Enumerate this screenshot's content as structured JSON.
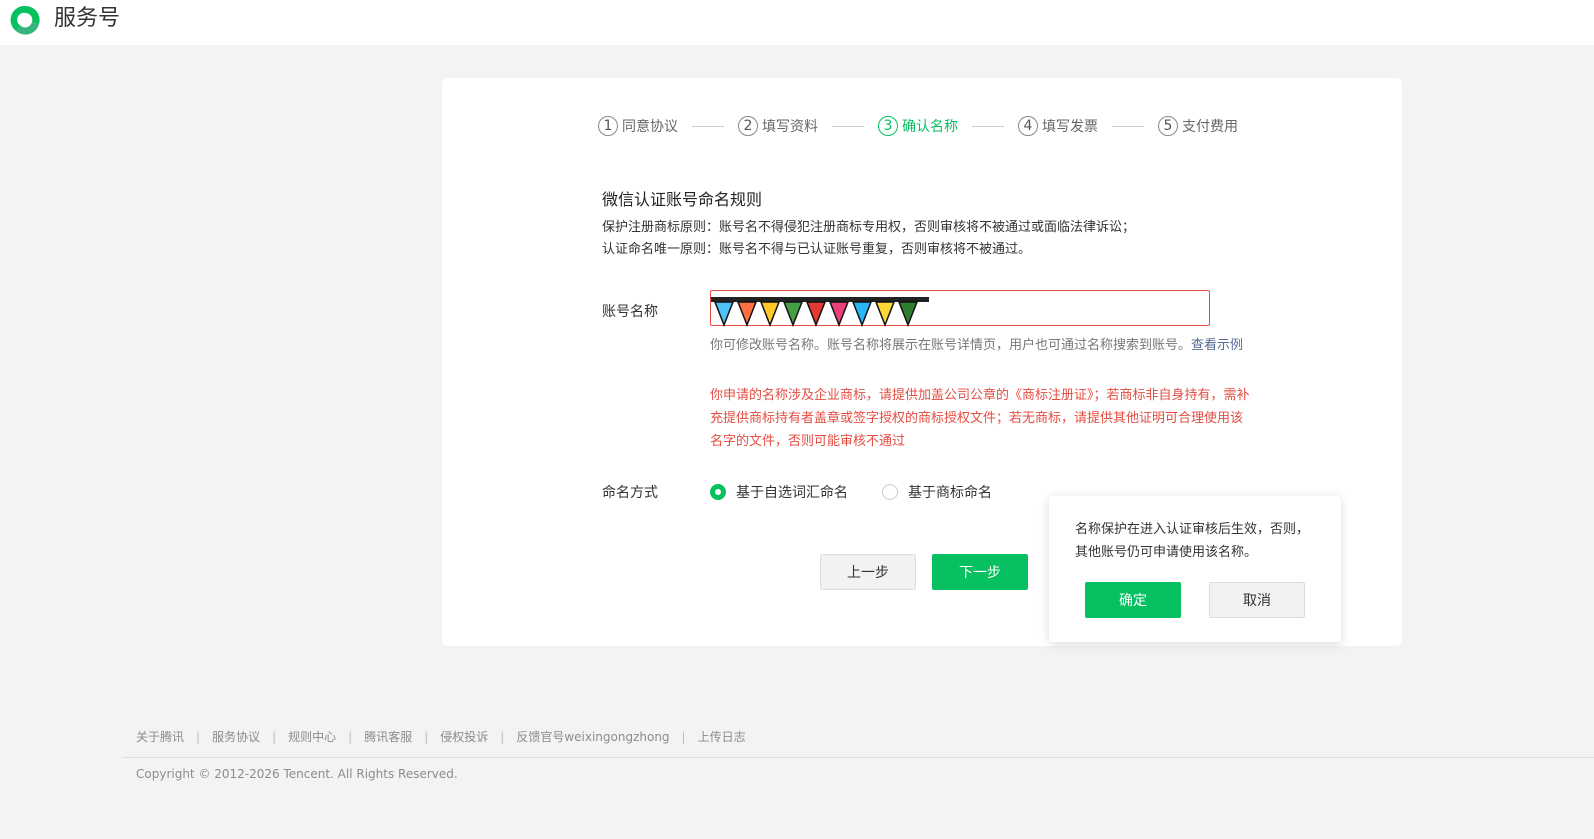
{
  "header": {
    "brand": "服务号",
    "accent_color": "#07c160"
  },
  "steps": [
    {
      "num": "1",
      "label": "同意协议"
    },
    {
      "num": "2",
      "label": "填写资料"
    },
    {
      "num": "3",
      "label": "确认名称"
    },
    {
      "num": "4",
      "label": "填写发票"
    },
    {
      "num": "5",
      "label": "支付费用"
    }
  ],
  "active_step": 3,
  "rules": {
    "title": "微信认证账号命名规则",
    "line1": "保护注册商标原则：账号名不得侵犯注册商标专用权，否则审核将不被通过或面临法律诉讼；",
    "line2": "认证命名唯一原则：账号名不得与已认证账号重复，否则审核将不被通过。"
  },
  "form": {
    "name_label": "账号名称",
    "name_value_icon": "flag-bunting-icon",
    "hint_text": "你可修改账号名称。账号名称将展示在账号详情页，用户也可通过名称搜索到账号。",
    "hint_link": "查看示例",
    "warning": "你申请的名称涉及企业商标，请提供加盖公司公章的《商标注册证》；若商标非自身持有，需补充提供商标持有者盖章或签字授权的商标授权文件；若无商标，请提供其他证明可合理使用该名字的文件，否则可能审核不通过",
    "naming_label": "命名方式",
    "options": [
      {
        "label": "基于自选词汇命名",
        "selected": true
      },
      {
        "label": "基于商标命名",
        "selected": false
      }
    ]
  },
  "buttons": {
    "prev": "上一步",
    "next": "下一步"
  },
  "popover": {
    "text": "名称保护在进入认证审核后生效，否则，其他账号仍可申请使用该名称。",
    "ok": "确定",
    "cancel": "取消"
  },
  "footer": {
    "links": [
      "关于腾讯",
      "服务协议",
      "规则中心",
      "腾讯客服",
      "侵权投诉",
      "反馈官号weixingongzhong",
      "上传日志"
    ],
    "copyright": "Copyright © 2012-2026 Tencent. All Rights Reserved."
  }
}
